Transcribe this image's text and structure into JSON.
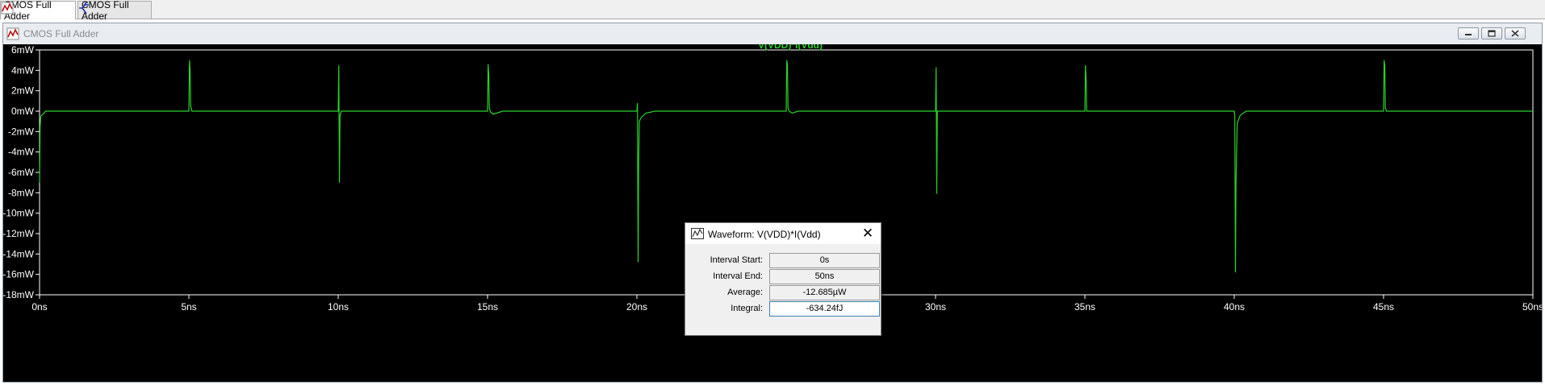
{
  "tabs": [
    {
      "label": "CMOS Full Adder",
      "icon": "waveform-plot-icon",
      "active": true
    },
    {
      "label": "CMOS Full Adder",
      "icon": "schematic-icon",
      "active": false
    }
  ],
  "window": {
    "title": "CMOS Full Adder",
    "icon": "waveform-plot-icon"
  },
  "colors": {
    "trace": "#28d228",
    "axis": "#ffffff",
    "background": "#000000"
  },
  "chart_data": {
    "type": "line",
    "title": "V(VDD)*I(Vdd)",
    "xlabel": "",
    "ylabel": "",
    "xlim": [
      0,
      50
    ],
    "ylim": [
      -18,
      6
    ],
    "x_ticks": [
      "0ns",
      "5ns",
      "10ns",
      "15ns",
      "20ns",
      "25ns",
      "30ns",
      "35ns",
      "40ns",
      "45ns",
      "50ns"
    ],
    "y_ticks": [
      "6mW",
      "4mW",
      "2mW",
      "0mW",
      "-2mW",
      "-4mW",
      "-6mW",
      "-8mW",
      "-10mW",
      "-12mW",
      "-14mW",
      "-16mW",
      "-18mW"
    ],
    "series": [
      {
        "name": "V(VDD)*I(Vdd)",
        "x_unit": "ns",
        "y_unit": "mW",
        "x": [
          0,
          0.02,
          0.04,
          0.15,
          0.2,
          5,
          5.02,
          5.04,
          5.06,
          5.1,
          10,
          10.02,
          10.04,
          10.06,
          10.1,
          15,
          15.02,
          15.04,
          15.06,
          15.1,
          15.2,
          15.3,
          15.5,
          20,
          20.02,
          20.04,
          20.06,
          20.08,
          20.15,
          20.3,
          20.6,
          25,
          25.02,
          25.04,
          25.06,
          25.1,
          25.2,
          25.4,
          30,
          30.02,
          30.04,
          30.06,
          35,
          35.02,
          35.04,
          35.06,
          40,
          40.02,
          40.04,
          40.06,
          40.1,
          40.2,
          40.4,
          45,
          45.02,
          45.04,
          45.06,
          45.1,
          50
        ],
        "y": [
          -7,
          -1.5,
          -0.5,
          -0.2,
          0,
          0,
          5,
          4,
          0.5,
          0,
          0,
          4.5,
          -7,
          -0.5,
          0,
          0,
          4.6,
          3.5,
          0.3,
          -0.1,
          -0.3,
          -0.2,
          0,
          0,
          0.8,
          -14.8,
          -5,
          -1,
          -0.6,
          -0.2,
          0,
          0,
          5,
          4.5,
          0.3,
          0,
          -0.2,
          0,
          0,
          4.3,
          -8.1,
          0,
          0,
          4.5,
          3.2,
          0,
          0,
          -0.5,
          -15.8,
          -7,
          -1.2,
          -0.4,
          0,
          0,
          5,
          4.5,
          0.3,
          0,
          0
        ]
      }
    ]
  },
  "dialog": {
    "title": "Waveform: V(VDD)*I(Vdd)",
    "title_icon": "measure-waveform-icon",
    "close_icon": "close-icon",
    "rows": [
      {
        "label": "Interval Start:",
        "value": "0s"
      },
      {
        "label": "Interval End:",
        "value": "50ns"
      },
      {
        "label": "Average:",
        "value": "-12.685µW"
      },
      {
        "label": "Integral:",
        "value": "-634.24fJ"
      }
    ]
  }
}
